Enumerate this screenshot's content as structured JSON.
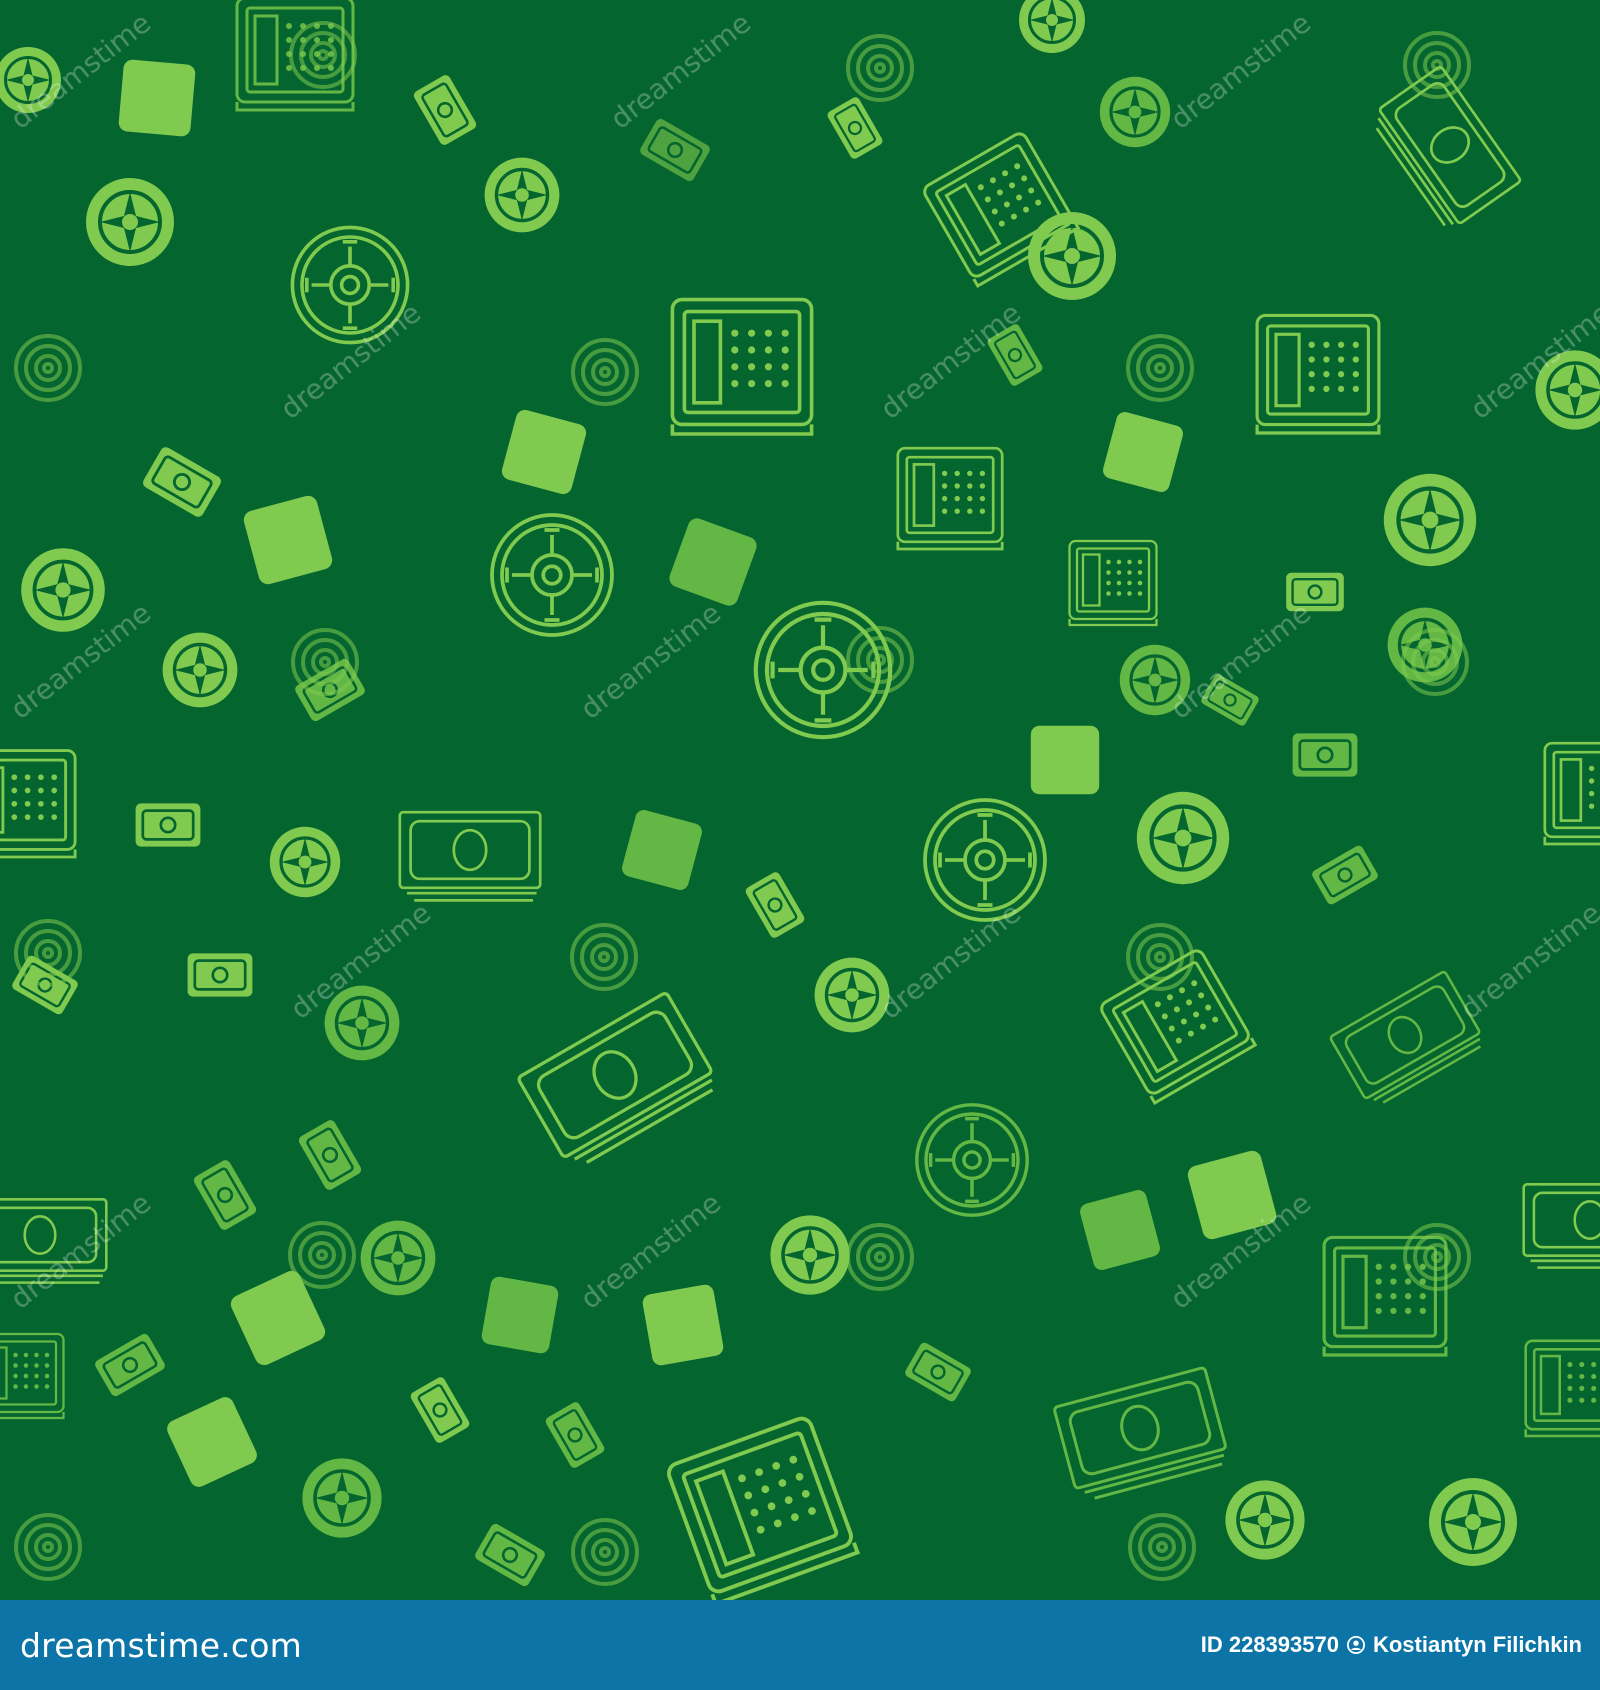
{
  "image": {
    "subject": "seamless pattern: safes, bank vault doors, money bill stacks",
    "background_color": "#05652f",
    "icon_colors": [
      "#7fca4f",
      "#62b745",
      "#4ea23f"
    ],
    "icon_names": [
      "safe-icon",
      "vault-door-icon",
      "money-stack-icon",
      "money-bill-icon"
    ]
  },
  "watermark": {
    "text": "dreamstime"
  },
  "footer": {
    "brand": "dreamstime.com",
    "image_id": "ID 228393570",
    "author": "Kostiantyn Filichkin",
    "color": "#0d74a8"
  }
}
